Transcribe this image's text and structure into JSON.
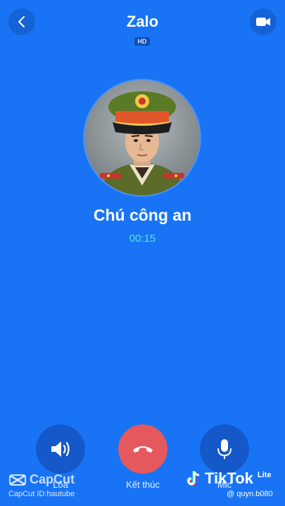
{
  "header": {
    "title": "Zalo",
    "hd_badge": "HD",
    "back_icon": "chevron-left-icon",
    "video_icon": "video-camera-icon"
  },
  "contact": {
    "name": "Chú công an",
    "timer": "00:15",
    "avatar": "police-officer-portrait"
  },
  "controls": {
    "speaker_label": "Loa",
    "end_label": "Kết thúc",
    "mic_label": "Mic"
  },
  "watermarks": {
    "capcut_logo": "CapCut",
    "capcut_id": "CapCut ID:hautube",
    "tiktok_logo": "TikTok",
    "tiktok_lite": "Lite",
    "tiktok_user": "@ quyn.b080"
  },
  "colors": {
    "background": "#1874f5",
    "end_call": "#e5585e",
    "timer": "#5de1e6",
    "control": "#1558c9"
  }
}
